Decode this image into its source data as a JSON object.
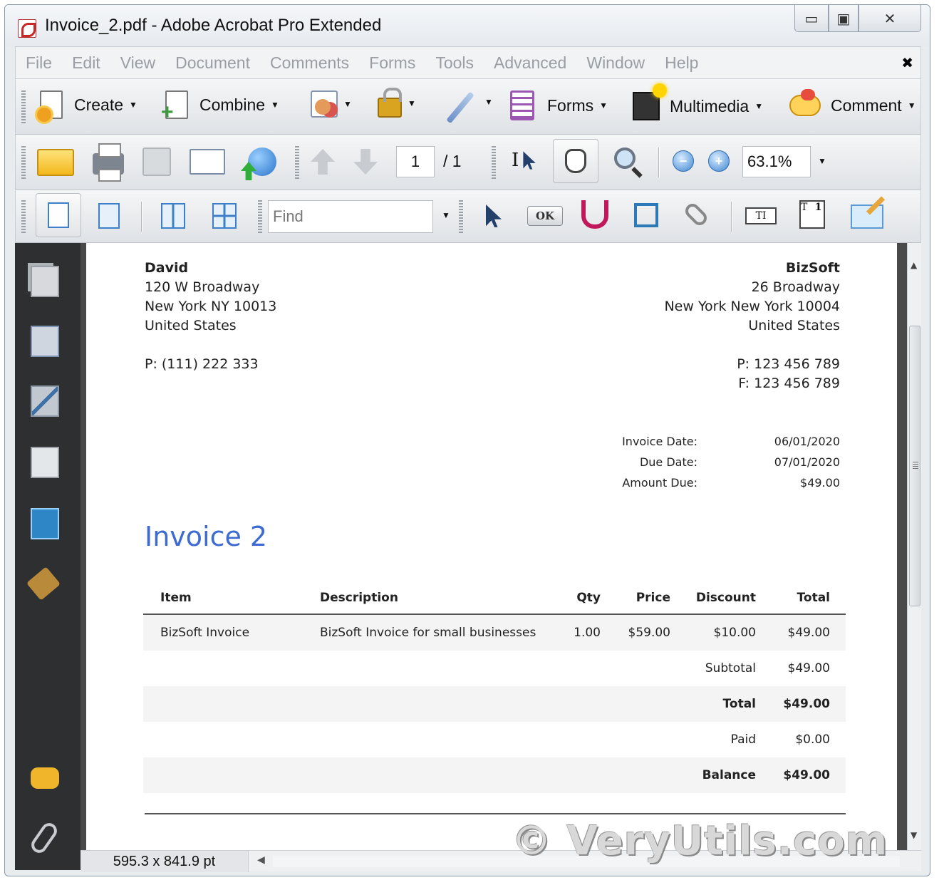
{
  "window": {
    "title": "Invoice_2.pdf - Adobe Acrobat Pro Extended",
    "min_glyph": "▭",
    "max_glyph": "▣",
    "close_glyph": "✕"
  },
  "menubar": {
    "items": [
      "File",
      "Edit",
      "View",
      "Document",
      "Comments",
      "Forms",
      "Tools",
      "Advanced",
      "Window",
      "Help"
    ],
    "close_glyph": "✖"
  },
  "toolbar_tasks": {
    "create_label": "Create",
    "combine_label": "Combine",
    "forms_label": "Forms",
    "multimedia_label": "Multimedia",
    "comment_label": "Comment",
    "caret": "▼"
  },
  "toolbar_nav": {
    "page_current": "1",
    "page_total": "/ 1",
    "zoom_value": "63.1%",
    "zoom_out_glyph": "−",
    "zoom_in_glyph": "+",
    "select_text_glyph": "I",
    "caret": "▼"
  },
  "toolbar_view": {
    "find_placeholder": "Find",
    "ok_label": "OK",
    "textfield_label": "TI",
    "textsel_label": "T",
    "textsel_num": "1",
    "caret": "▼"
  },
  "document": {
    "from": {
      "name": "David",
      "address1": "120 W Broadway",
      "address2": "New York NY 10013",
      "country": "United States",
      "phone": "P: (111) 222 333"
    },
    "company": {
      "name": "BizSoft",
      "address1": "26 Broadway",
      "address2": "New York New York 10004",
      "country": "United States",
      "phone": "P: 123 456 789",
      "fax": "F: 123 456 789"
    },
    "meta": {
      "invoice_date_label": "Invoice Date:",
      "invoice_date": "06/01/2020",
      "due_date_label": "Due Date:",
      "due_date": "07/01/2020",
      "amount_due_label": "Amount Due:",
      "amount_due": "$49.00"
    },
    "invoice_title": "Invoice 2",
    "table": {
      "headers": {
        "item": "Item",
        "description": "Description",
        "qty": "Qty",
        "price": "Price",
        "discount": "Discount",
        "total": "Total"
      },
      "rows": [
        {
          "item": "BizSoft Invoice",
          "description": "BizSoft Invoice for small businesses",
          "qty": "1.00",
          "price": "$59.00",
          "discount": "$10.00",
          "total": "$49.00"
        }
      ],
      "summary": {
        "subtotal_label": "Subtotal",
        "subtotal": "$49.00",
        "total_label": "Total",
        "total": "$49.00",
        "paid_label": "Paid",
        "paid": "$0.00",
        "balance_label": "Balance",
        "balance": "$49.00"
      }
    }
  },
  "scrollbar": {
    "up_glyph": "▲",
    "down_glyph": "▼",
    "left_glyph": "◀"
  },
  "statusbar": {
    "page_size": "595.3 x 841.9 pt"
  },
  "watermark": "© VeryUtils.com",
  "colors": {
    "accent_title": "#3d6bd2",
    "nav_pane": "#2e2f31"
  }
}
